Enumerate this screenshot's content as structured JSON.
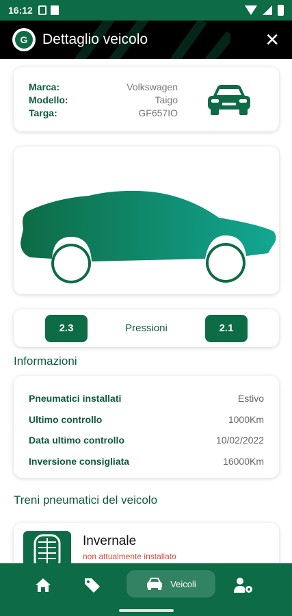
{
  "status_bar": {
    "time": "16:12"
  },
  "header": {
    "logo_letter": "G",
    "title": "Dettaglio veicolo",
    "close_glyph": "✕"
  },
  "vehicle": {
    "rows": [
      {
        "key": "Marca:",
        "value": "Volkswagen"
      },
      {
        "key": "Modello:",
        "value": "Taigo"
      },
      {
        "key": "Targa:",
        "value": "GF657IO"
      }
    ]
  },
  "pressures": {
    "left": "2.3",
    "label": "Pressioni",
    "right": "2.1"
  },
  "info": {
    "section_title": "Informazioni",
    "rows": [
      {
        "key": "Pneumatici installati",
        "value": "Estivo"
      },
      {
        "key": "Ultimo controllo",
        "value": "1000Km"
      },
      {
        "key": "Data ultimo controllo",
        "value": "10/02/2022"
      },
      {
        "key": "Inversione consigliata",
        "value": "16000Km"
      }
    ]
  },
  "trains": {
    "section_title": "Treni pneumatici del veicolo",
    "items": [
      {
        "name": "Invernale",
        "status": "non attualmente installato"
      }
    ]
  },
  "nav": {
    "vehicles_label": "Veicoli"
  },
  "colors": {
    "brand_green": "#0d6b45",
    "header_bg": "#000000",
    "status_red": "#e0473b"
  },
  "icons": [
    "home-icon",
    "tag-icon",
    "car-icon",
    "user-settings-icon",
    "tire-icon",
    "close-icon"
  ]
}
